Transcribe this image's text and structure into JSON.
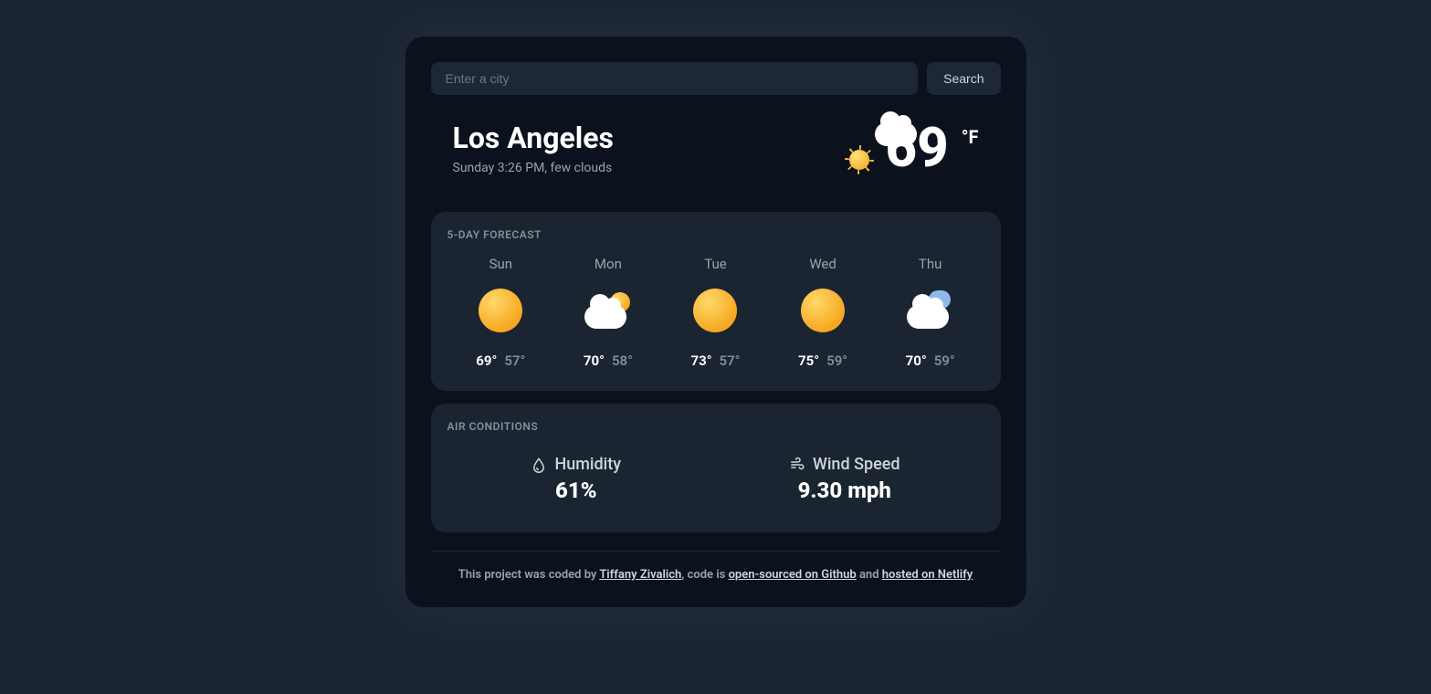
{
  "search": {
    "placeholder": "Enter a city",
    "button_label": "Search"
  },
  "current": {
    "city": "Los Angeles",
    "subline": "Sunday 3:26 PM, few clouds",
    "temp": "69",
    "unit": "°F",
    "icon": "few-clouds"
  },
  "forecast": {
    "title": "5-DAY FORECAST",
    "days": [
      {
        "name": "Sun",
        "icon": "sun",
        "hi": "69°",
        "lo": "57°"
      },
      {
        "name": "Mon",
        "icon": "cloud-sun",
        "hi": "70°",
        "lo": "58°"
      },
      {
        "name": "Tue",
        "icon": "sun",
        "hi": "73°",
        "lo": "57°"
      },
      {
        "name": "Wed",
        "icon": "sun",
        "hi": "75°",
        "lo": "59°"
      },
      {
        "name": "Thu",
        "icon": "cloud",
        "hi": "70°",
        "lo": "59°"
      }
    ]
  },
  "air": {
    "title": "AIR CONDITIONS",
    "humidity_label": "Humidity",
    "humidity_value": "61%",
    "wind_label": "Wind Speed",
    "wind_value": "9.30 mph"
  },
  "footer": {
    "prefix": "This project was coded by ",
    "author": "Tiffany Zivalich",
    "mid1": ", code is ",
    "link1": "open-sourced on Github",
    "mid2": " and ",
    "link2": "hosted on Netlify"
  }
}
